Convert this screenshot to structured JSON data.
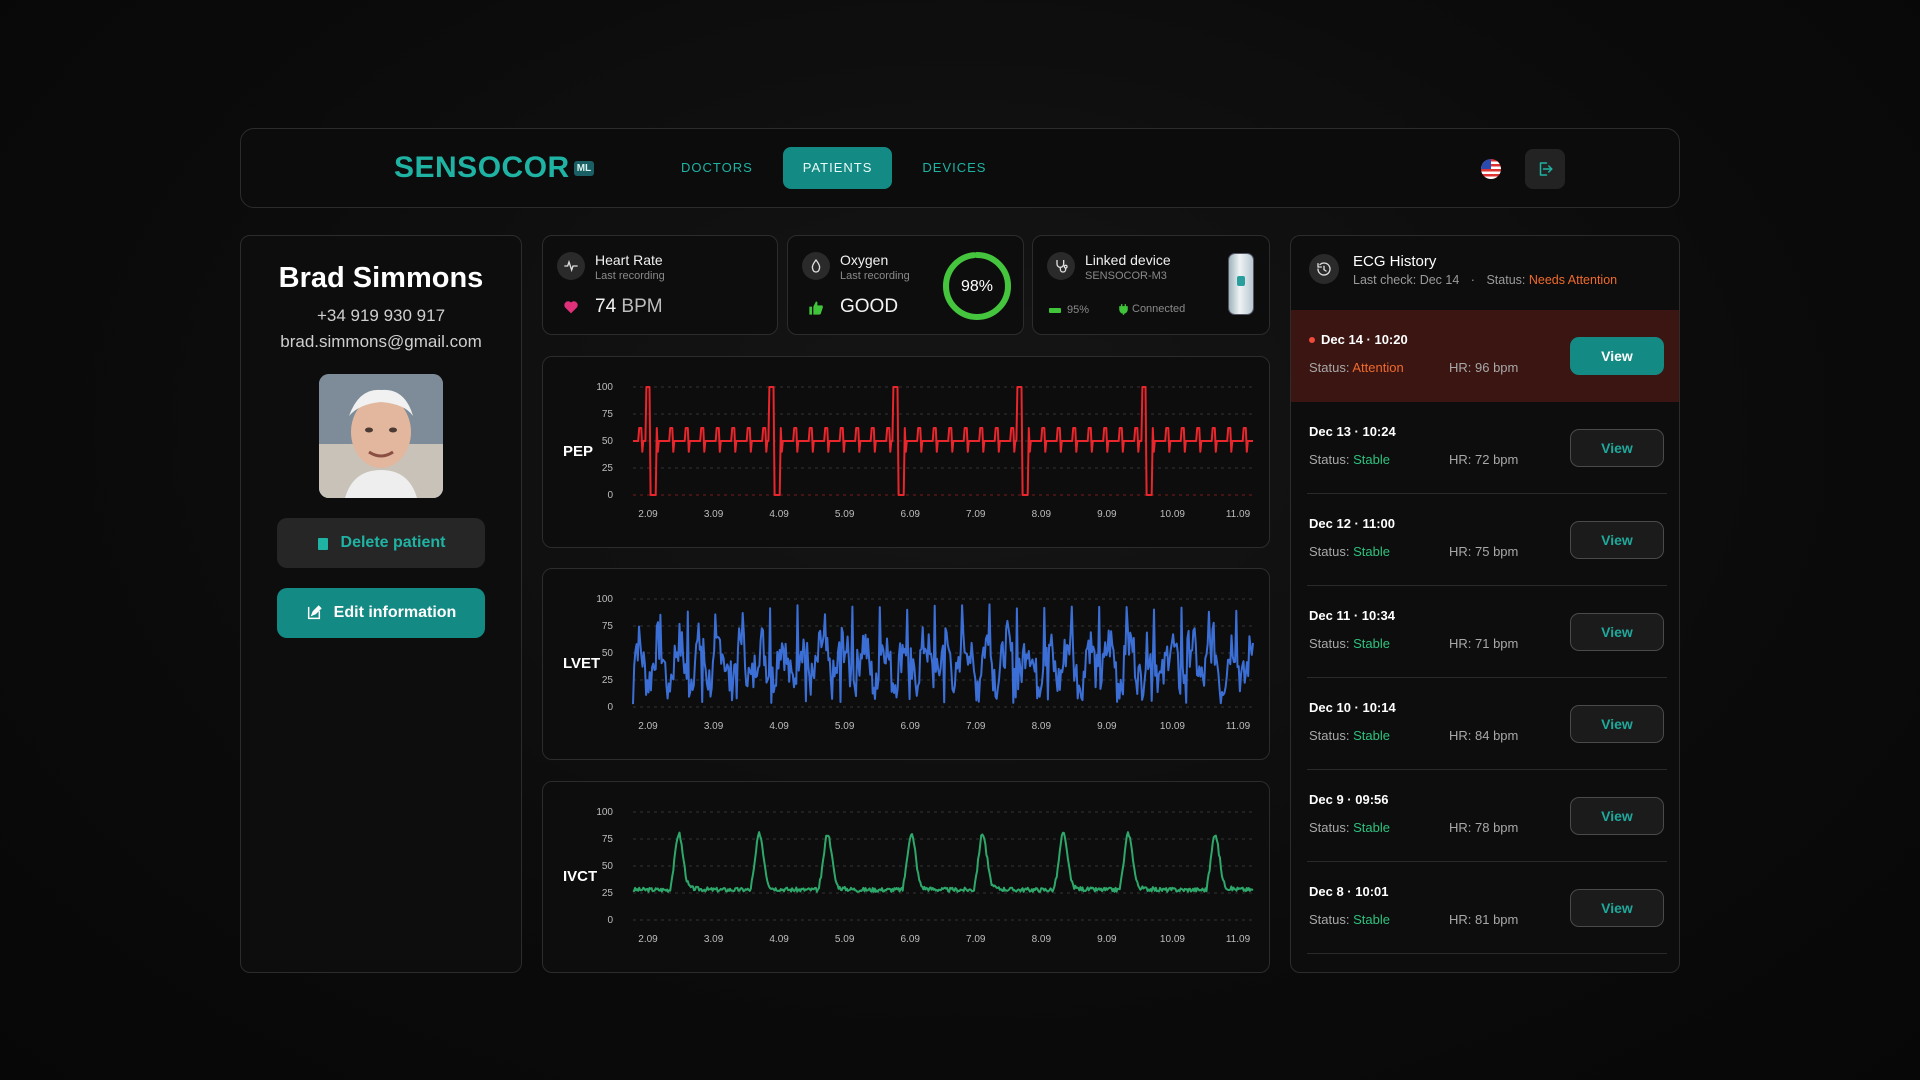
{
  "brand": {
    "name": "SENSOCOR",
    "badge": "ML"
  },
  "nav": [
    {
      "label": "DOCTORS",
      "active": false
    },
    {
      "label": "PATIENTS",
      "active": true
    },
    {
      "label": "DEVICES",
      "active": false
    }
  ],
  "header_icons": {
    "flag": "us-flag-icon",
    "logout": "logout-icon"
  },
  "patient": {
    "name": "Brad Simmons",
    "phone": "+34 919 930 917",
    "email": "brad.simmons@gmail.com",
    "delete_label": "Delete patient",
    "edit_label": "Edit information"
  },
  "heart_rate": {
    "title": "Heart Rate",
    "subtitle": "Last recording",
    "value": "74",
    "unit": "BPM"
  },
  "oxygen": {
    "title": "Oxygen",
    "subtitle": "Last recording",
    "status": "GOOD",
    "percent_label": "98%",
    "percent": 98
  },
  "device": {
    "title": "Linked device",
    "model": "SENSOCOR-M3",
    "battery": "95%",
    "connection": "Connected"
  },
  "charts": {
    "pep": {
      "label": "PEP"
    },
    "lvet": {
      "label": "LVET"
    },
    "ivct": {
      "label": "IVCT"
    }
  },
  "chart_data": [
    {
      "type": "line",
      "title": "PEP",
      "x": [
        "2.09",
        "3.09",
        "4.09",
        "5.09",
        "6.09",
        "7.09",
        "8.09",
        "9.09",
        "10.09",
        "11.09"
      ],
      "yticks": [
        0,
        25,
        50,
        75,
        100
      ],
      "ylim": [
        0,
        100
      ],
      "color": "#e8262c",
      "grid": "dashed",
      "description_values": {
        "baseline": 50,
        "peak": 100,
        "trough": 0,
        "beats": 5
      }
    },
    {
      "type": "line",
      "title": "LVET",
      "x": [
        "2.09",
        "3.09",
        "4.09",
        "5.09",
        "6.09",
        "7.09",
        "8.09",
        "9.09",
        "10.09",
        "11.09"
      ],
      "yticks": [
        0,
        25,
        50,
        75,
        100
      ],
      "ylim": [
        0,
        100
      ],
      "color": "#3b6fd6",
      "grid": "dashed",
      "description_values": {
        "baseline": 40,
        "max": 100,
        "min": 0
      }
    },
    {
      "type": "line",
      "title": "IVCT",
      "x": [
        "2.09",
        "3.09",
        "4.09",
        "5.09",
        "6.09",
        "7.09",
        "8.09",
        "9.09",
        "10.09",
        "11.09"
      ],
      "yticks": [
        0,
        25,
        50,
        75,
        100
      ],
      "ylim": [
        0,
        100
      ],
      "color": "#2ea86a",
      "grid": "dashed",
      "description_values": {
        "baseline": 28,
        "peak": 80,
        "beats": 8
      }
    }
  ],
  "history": {
    "title": "ECG History",
    "last_check": "Last check: Dec 14",
    "status_prefix": "Status:",
    "status_value": "Needs Attention",
    "view_label": "View",
    "rows": [
      {
        "date": "Dec 14 · 10:20",
        "status": "Attention",
        "hr": "HR: 96 bpm",
        "alert": true
      },
      {
        "date": "Dec 13 · 10:24",
        "status": "Stable",
        "hr": "HR: 72 bpm",
        "alert": false
      },
      {
        "date": "Dec 12 · 11:00",
        "status": "Stable",
        "hr": "HR: 75 bpm",
        "alert": false
      },
      {
        "date": "Dec 11 · 10:34",
        "status": "Stable",
        "hr": "HR: 71 bpm",
        "alert": false
      },
      {
        "date": "Dec 10 · 10:14",
        "status": "Stable",
        "hr": "HR: 84 bpm",
        "alert": false
      },
      {
        "date": "Dec 9 · 09:56",
        "status": "Stable",
        "hr": "HR: 78 bpm",
        "alert": false
      },
      {
        "date": "Dec 8 · 10:01",
        "status": "Stable",
        "hr": "HR: 81 bpm",
        "alert": false
      }
    ]
  },
  "status_label": "Status:"
}
